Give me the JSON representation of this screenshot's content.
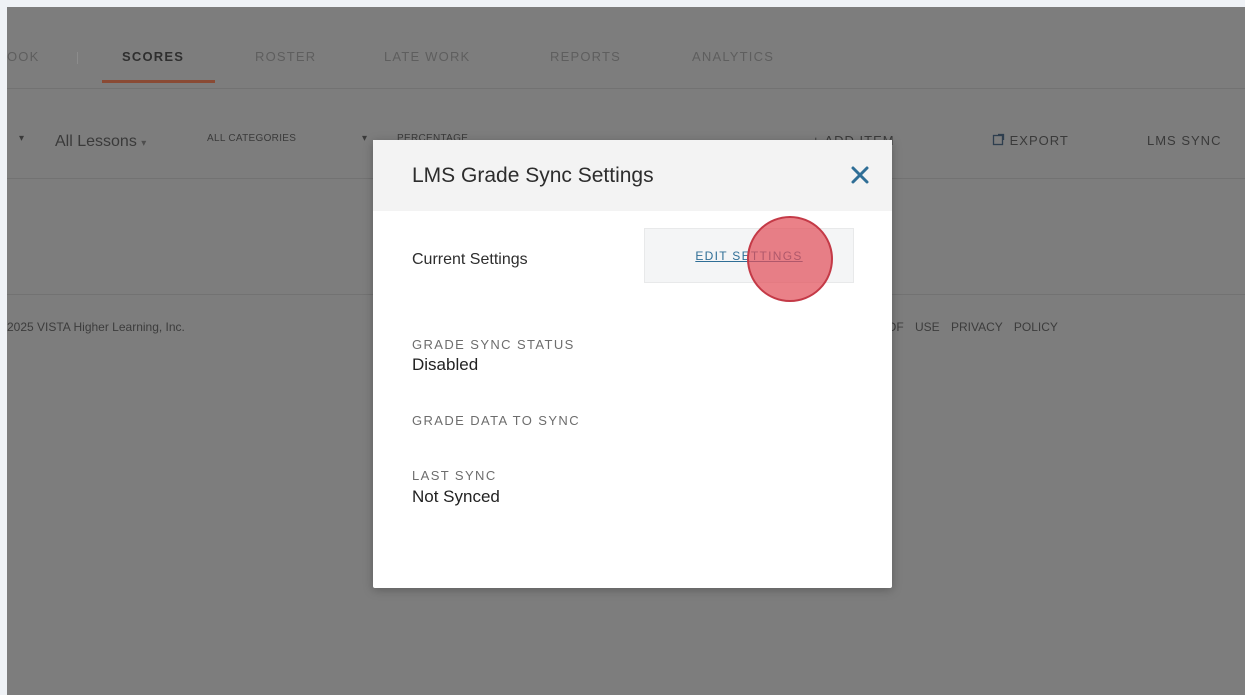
{
  "nav": {
    "tabs": [
      {
        "label": "ook",
        "active": false
      },
      {
        "label": "SCORES",
        "active": true
      },
      {
        "label": "ROSTER",
        "active": false
      },
      {
        "label": "LATE WORK",
        "active": false
      },
      {
        "label": "REPORTS",
        "active": false
      },
      {
        "label": "ANALYTICS",
        "active": false
      }
    ]
  },
  "toolbar": {
    "lessons_label": "All Lessons",
    "categories_label": "ALL CATEGORIES",
    "display_label": "PERCENTAGE",
    "add_item_label": "ADD ITEM",
    "export_label": "EXPORT",
    "lms_sync_label": "LMS SYNC"
  },
  "footer": {
    "copyright": "2025 VISTA Higher Learning, Inc.",
    "terms": "OF USE",
    "privacy": "PRIVACY POLICY"
  },
  "modal": {
    "title": "LMS Grade Sync Settings",
    "current_settings_label": "Current Settings",
    "edit_settings_label": "EDIT SETTINGS",
    "grade_sync_status_label": "GRADE SYNC STATUS",
    "grade_sync_status_value": "Disabled",
    "grade_data_label": "GRADE DATA TO SYNC",
    "last_sync_label": "LAST SYNC",
    "last_sync_value": "Not Synced"
  },
  "colors": {
    "overlay": "#7d7d7d",
    "active_tab_underline": "#8a4a34",
    "link": "#2f6e96",
    "close_icon": "#2f6e96",
    "click_indicator": "#e2505a"
  }
}
